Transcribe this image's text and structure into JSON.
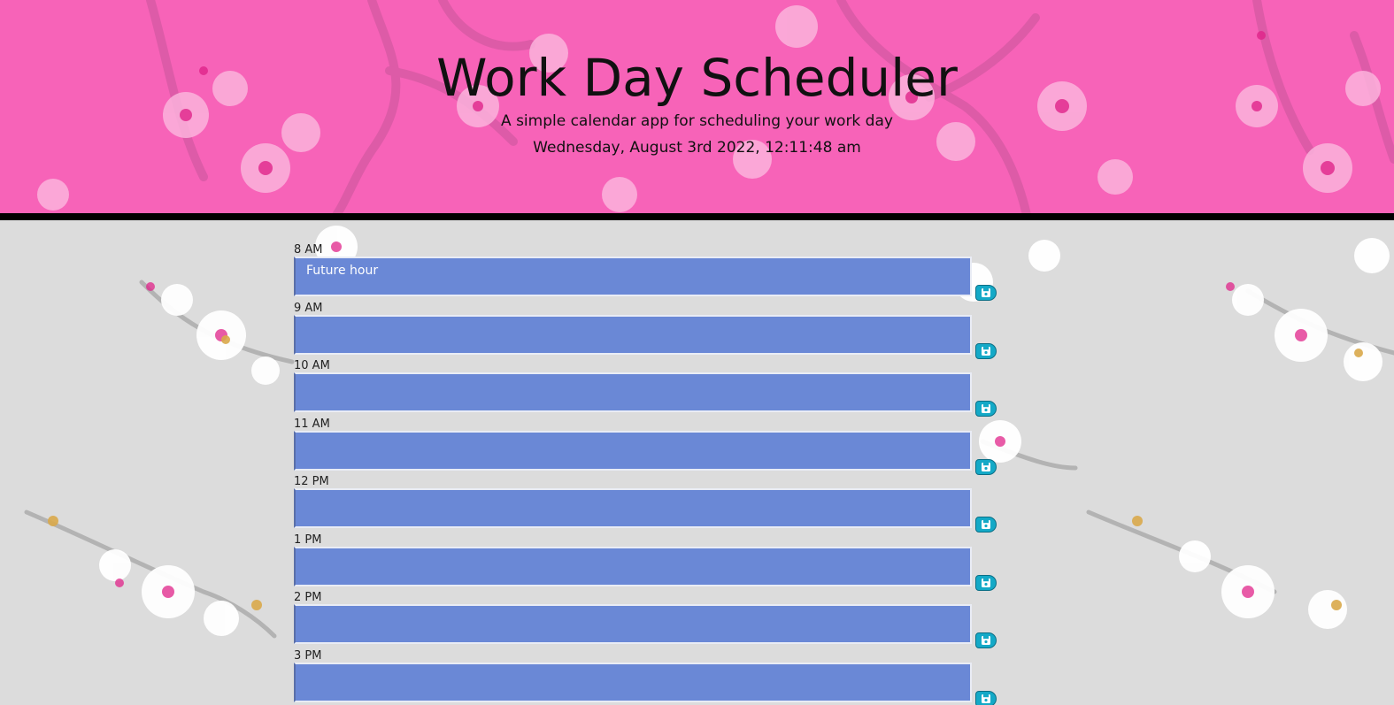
{
  "header": {
    "title": "Work Day Scheduler",
    "subtitle": "A simple calendar app for scheduling your work day",
    "datetime": "Wednesday, August 3rd 2022, 12:11:48 am"
  },
  "colors": {
    "header_bg": "#f763b8",
    "slot_future": "#6a88d6",
    "save_button": "#14a9c7",
    "divider": "#000000"
  },
  "slots": [
    {
      "hour": "8 AM",
      "placeholder": "Future hour",
      "value": ""
    },
    {
      "hour": "9 AM",
      "placeholder": "",
      "value": ""
    },
    {
      "hour": "10 AM",
      "placeholder": "",
      "value": ""
    },
    {
      "hour": "11 AM",
      "placeholder": "",
      "value": ""
    },
    {
      "hour": "12 PM",
      "placeholder": "",
      "value": ""
    },
    {
      "hour": "1 PM",
      "placeholder": "",
      "value": ""
    },
    {
      "hour": "2 PM",
      "placeholder": "",
      "value": ""
    },
    {
      "hour": "3 PM",
      "placeholder": "",
      "value": ""
    }
  ],
  "icons": {
    "save": "floppy-disk-icon",
    "decoration": "cherry-blossom-branch"
  }
}
